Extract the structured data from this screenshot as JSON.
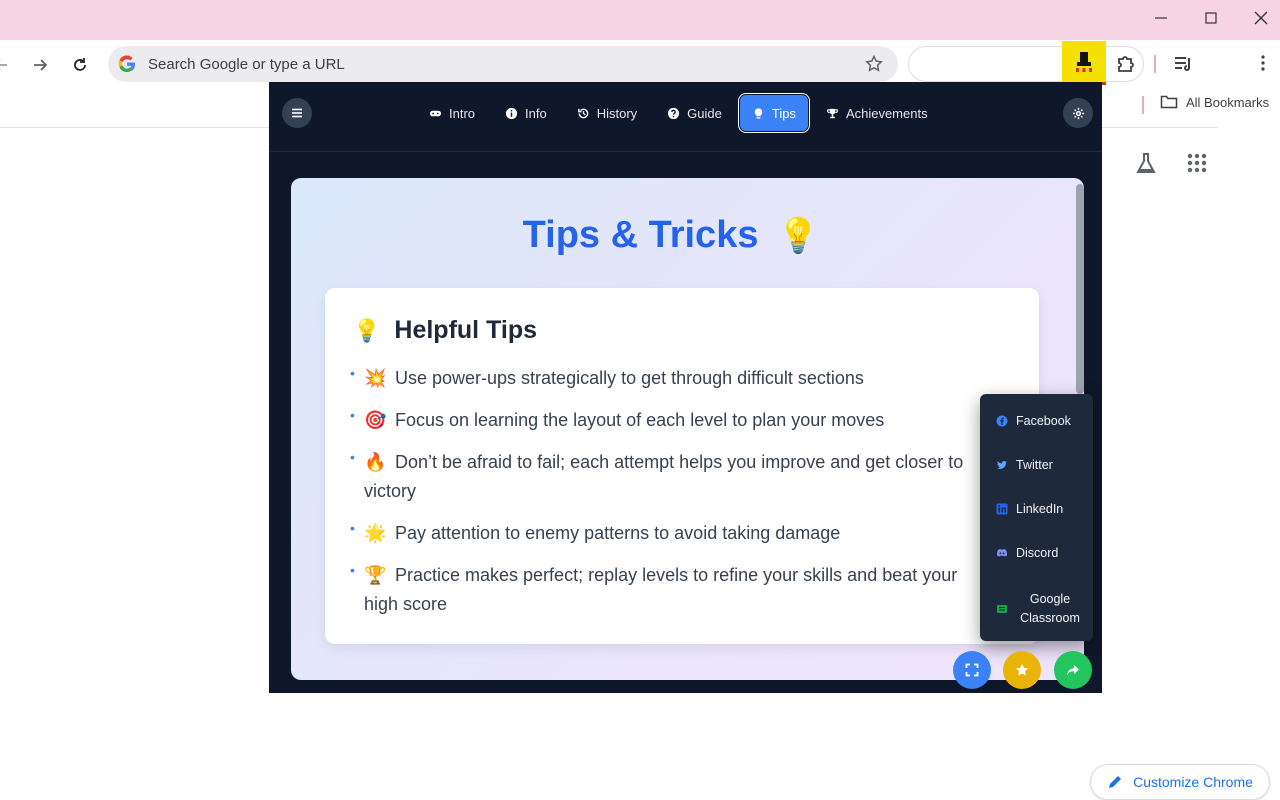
{
  "browser": {
    "omnibox_placeholder": "Search Google or type a URL",
    "bookmarks_label": "All Bookmarks",
    "customize_label": "Customize Chrome"
  },
  "nav": {
    "tabs": [
      {
        "label": "Intro",
        "icon": "gamepad-icon"
      },
      {
        "label": "Info",
        "icon": "info-icon"
      },
      {
        "label": "History",
        "icon": "history-icon"
      },
      {
        "label": "Guide",
        "icon": "question-icon"
      },
      {
        "label": "Tips",
        "icon": "lightbulb-icon",
        "active": true
      },
      {
        "label": "Achievements",
        "icon": "trophy-icon"
      }
    ]
  },
  "main": {
    "title": "Tips & Tricks",
    "title_emoji": "💡",
    "section": {
      "heading": "Helpful Tips",
      "heading_emoji": "💡",
      "tips": [
        {
          "emoji": "💥",
          "text": "Use power-ups strategically to get through difficult sections"
        },
        {
          "emoji": "🎯",
          "text": "Focus on learning the layout of each level to plan your moves"
        },
        {
          "emoji": "🔥",
          "text": "Don’t be afraid to fail; each attempt helps you improve and get closer to victory"
        },
        {
          "emoji": "🌟",
          "text": "Pay attention to enemy patterns to avoid taking damage"
        },
        {
          "emoji": "🏆",
          "text": "Practice makes perfect; replay levels to refine your skills and beat your high score"
        }
      ]
    }
  },
  "share_menu": {
    "facebook": "Facebook",
    "twitter": "Twitter",
    "linkedin": "LinkedIn",
    "discord": "Discord",
    "google_classroom": "Google Classroom"
  },
  "colors": {
    "accent": "#3b82f6",
    "title": "#2563eb",
    "popup_bg": "#0f172a",
    "fab_fullscreen": "#3b82f6",
    "fab_favorite": "#eab308",
    "fab_share": "#22c55e"
  }
}
